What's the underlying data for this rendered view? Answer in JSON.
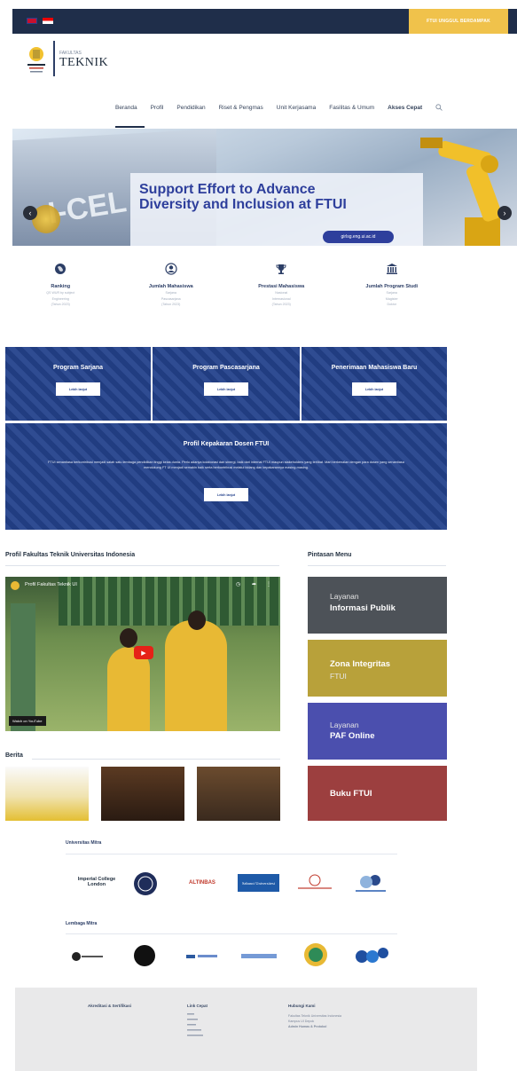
{
  "topbar": {
    "cta_label": "FTUI UNGGUL BERDAMPAK"
  },
  "header": {
    "faculty_small": "FAKULTAS",
    "faculty_title": "TEKNIK"
  },
  "nav": {
    "items": [
      "Beranda",
      "Profil",
      "Pendidikan",
      "Riset & Pengmas",
      "Unit Kerjasama",
      "Fasilitas & Umum",
      "Akses Cepat"
    ]
  },
  "hero": {
    "sign_text": "I-CEL",
    "headline_line1": "Support Effort to Advance",
    "headline_line2": "Diversity and Inclusion at FTUI",
    "url": "girlsg.eng.ui.ac.id"
  },
  "stats": [
    {
      "icon": "globe-icon",
      "label": "Ranking",
      "lines": [
        "QS WUR by subject",
        "Engineering",
        "(Tahun 2023)"
      ]
    },
    {
      "icon": "user-icon",
      "label": "Jumlah Mahasiswa",
      "lines": [
        "Sarjana",
        "Pascasarjana",
        "(Tahun 2023)"
      ]
    },
    {
      "icon": "trophy-icon",
      "label": "Prestasi Mahasiswa",
      "lines": [
        "Nasional",
        "Internasional",
        "(Tahun 2023)"
      ]
    },
    {
      "icon": "institution-icon",
      "label": "Jumlah Program Studi",
      "lines": [
        "Sarjana",
        "Magister",
        "Doktor"
      ]
    }
  ],
  "programs": {
    "sarjana": "Program Sarjana",
    "pascasarjana": "Program Pascasarjana",
    "penerimaan": "Penerimaan Mahasiswa Baru",
    "btn_label": "Lebih lanjut",
    "dosen_title": "Profil Kepakaran Dosen FTUI",
    "dosen_desc": "FTUI senantiasa berkontribusi menjadi salah satu lembaga pendidikan tinggi kelas dunia. Perlu adanya kolaborasi dan sinergi, baik dari internal FTUI maupun stakeholders yang terlibat. Mari berkenalan dengan para dosen yang senantiasa mendukung FT UI menjadi semakin baik serta berkontribusi melalui bidang dan kepakarannya masing-masing."
  },
  "profile": {
    "heading": "Profil Fakultas Teknik Universitas Indonesia",
    "video_title": "Profil Fakultas Teknik UI",
    "watch_label": "Watch on YouTube"
  },
  "shortcut_menu": {
    "heading": "Pintasan Menu",
    "items": [
      {
        "light": "Layanan",
        "bold": "Informasi Publik"
      },
      {
        "light": "FTUI",
        "bold": "Zona Integritas"
      },
      {
        "light": "Layanan",
        "bold": "PAF Online"
      },
      {
        "light": "",
        "bold": "Buku FTUI"
      }
    ]
  },
  "news": {
    "heading": "Berita"
  },
  "partners": {
    "universities_heading": "Universitas Mitra",
    "universities": [
      "Imperial College London",
      "",
      "ALTINBAS",
      "Sabanci Universitesi",
      "",
      ""
    ],
    "institutions_heading": "Lembaga Mitra"
  },
  "footer": {
    "col1_title": "Akreditasi & Sertifikasi",
    "col2_title": "Link Cepat",
    "col3_title": "Hubungi Kami",
    "col3_lines": [
      "Fakultas Teknik Universitas Indonesia",
      "Kampus UI Depok",
      "Admin Humas & Protokol"
    ]
  }
}
